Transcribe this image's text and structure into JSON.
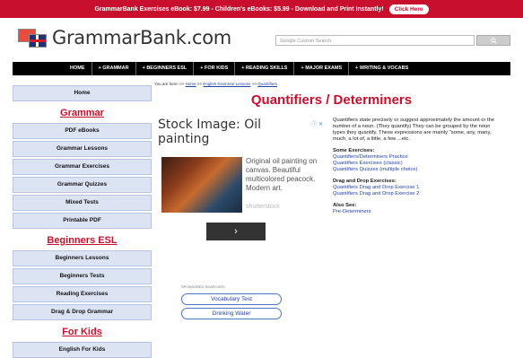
{
  "promo": {
    "text": "GrammarBank Exercises eBook: $7.99 - Children's eBooks: $5.99 - Download and Print Instantly!",
    "button": "Click Here"
  },
  "logo": {
    "text": "GrammarBank.com"
  },
  "search": {
    "placeholder": "Google Custom Search"
  },
  "nav": [
    "HOME",
    "+ GRAMMAR",
    "+ BEGINNERS ESL",
    "+ FOR KIDS",
    "+ READING SKILLS",
    "+ MAJOR EXAMS",
    "+ WRITING & VOCABS"
  ],
  "sidebar": {
    "home": "Home",
    "grammar_head": "Grammar",
    "grammar_items": [
      "PDF eBooks",
      "Grammar Lessons",
      "Grammar Exercises",
      "Grammar Quizzes",
      "Mixed Tests",
      "Printable PDF"
    ],
    "beginners_head": "Beginners ESL",
    "beginners_items": [
      "Beginners Lessons",
      "Beginners Tests",
      "Reading Exercises",
      "Drag & Drop Grammar"
    ],
    "kids_head": "For Kids",
    "kids_items": [
      "English For Kids"
    ]
  },
  "breadcrumb": {
    "prefix": "You are here:",
    "links": [
      "Home",
      "English Grammar Lessons",
      "Quantifiers"
    ]
  },
  "title": "Quantifiers / Determiners",
  "ad": {
    "title": "Stock Image: Oil painting",
    "description": "Original oil painting on canvas. Beautiful multicolored peacock. Modern art.",
    "source": "shutterstock",
    "arrow": "›",
    "choices": "ⓘ ✕",
    "sponsored": "SPONSORED SEARCHES",
    "pills": [
      "Vocabulary Test",
      "Drinking Water"
    ]
  },
  "article": {
    "intro": "Quantifiers state precisely or suggest approximately the amount or the number of a noun. (They quantify) They can be grouped by the noun types they quantify. These expressions are mainly \"some, any, many, much, a lot of, a little, a few ...etc.",
    "some_exercises_head": "Some Exercises:",
    "some_exercises": [
      "Quantifiers/Determiners Practice",
      "Quantifiers Exercises (classic)",
      "Quantifiers Quizzes (multiple choice)"
    ],
    "drag_head": "Drag and Drop Exercises:",
    "drag_items": [
      "Quantifiers Drag and Drop Exercise 1",
      "Quantifiers Drag and Drop Exercise 2"
    ],
    "also_head": "Also See:",
    "also_items": [
      "Pre-Determiners"
    ]
  }
}
